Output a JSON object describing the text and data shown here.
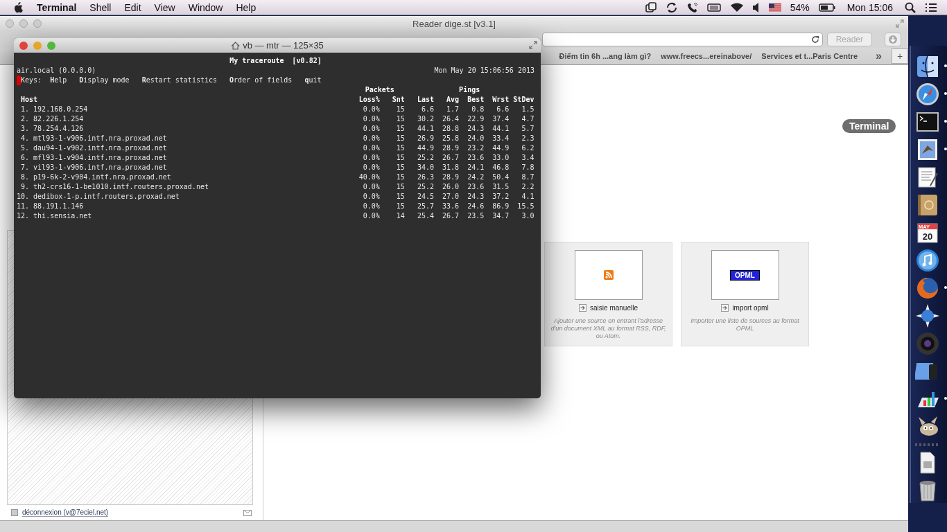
{
  "menu_bar": {
    "app": "Terminal",
    "menus": [
      "Shell",
      "Edit",
      "View",
      "Window",
      "Help"
    ],
    "battery": "54%",
    "clock": "Mon 15:06"
  },
  "browser": {
    "title": "Reader dige.st [v3.1]",
    "reader_button": "Reader",
    "bookmarks": [
      "Điểm tin 6h ...ang làm gì?",
      "www.freecs...ereinabove/",
      "Services et t...Paris Centre"
    ],
    "more": "»",
    "new_tab": "+",
    "sources": [
      {
        "kind": "rss",
        "label": "saisie manuelle",
        "description": "Ajouter une source en entrant l'adresse d'un document XML au format RSS, RDF, ou Atom."
      },
      {
        "kind": "opml",
        "badge": "OPML",
        "label": "import opml",
        "description": "Importer une liste de sources au format OPML"
      }
    ],
    "logout": "déconnexion (v@7eciel.net)"
  },
  "terminal": {
    "title": "vb — mtr — 125×35",
    "heading": "My traceroute  [v0.82]",
    "host": "air.local (0.0.0.0)",
    "timestamp": "Mon May 20 15:06:56 2013",
    "keys_label": "Keys:",
    "keys": [
      "**H**elp",
      "**D**isplay mode",
      "**R**estart statistics",
      "**O**rder of fields",
      "**q**uit"
    ],
    "groups": [
      "Packets",
      "Pings"
    ],
    "columns": [
      "Host",
      "Loss%",
      "Snt",
      "Last",
      "Avg",
      "Best",
      "Wrst",
      "StDev"
    ],
    "rows": [
      [
        "1. 192.168.0.254",
        "0.0%",
        "15",
        "6.6",
        "1.7",
        "0.8",
        "6.6",
        "1.5"
      ],
      [
        "2. 82.226.1.254",
        "0.0%",
        "15",
        "30.2",
        "26.4",
        "22.9",
        "37.4",
        "4.7"
      ],
      [
        "3. 78.254.4.126",
        "0.0%",
        "15",
        "44.1",
        "28.8",
        "24.3",
        "44.1",
        "5.7"
      ],
      [
        "4. mtl93-1-v906.intf.nra.proxad.net",
        "0.0%",
        "15",
        "26.9",
        "25.8",
        "24.0",
        "33.4",
        "2.3"
      ],
      [
        "5. dau94-1-v902.intf.nra.proxad.net",
        "0.0%",
        "15",
        "44.9",
        "28.9",
        "23.2",
        "44.9",
        "6.2"
      ],
      [
        "6. mfl93-1-v904.intf.nra.proxad.net",
        "0.0%",
        "15",
        "25.2",
        "26.7",
        "23.6",
        "33.0",
        "3.4"
      ],
      [
        "7. vil93-1-v906.intf.nra.proxad.net",
        "0.0%",
        "15",
        "34.0",
        "31.8",
        "24.1",
        "46.8",
        "7.8"
      ],
      [
        "8. p19-6k-2-v904.intf.nra.proxad.net",
        "40.0%",
        "15",
        "26.3",
        "28.9",
        "24.2",
        "50.4",
        "8.7"
      ],
      [
        "9. th2-crs16-1-be1010.intf.routers.proxad.net",
        "0.0%",
        "15",
        "25.2",
        "26.0",
        "23.6",
        "31.5",
        "2.2"
      ],
      [
        "10. dedibox-1-p.intf.routers.proxad.net",
        "0.0%",
        "15",
        "24.5",
        "27.0",
        "24.3",
        "37.2",
        "4.1"
      ],
      [
        "11. 88.191.1.146",
        "0.0%",
        "15",
        "25.7",
        "33.6",
        "24.6",
        "86.9",
        "15.5"
      ],
      [
        "12. thi.sensia.net",
        "0.0%",
        "14",
        "25.4",
        "26.7",
        "23.5",
        "34.7",
        "3.0"
      ]
    ]
  },
  "dock": {
    "tooltip": "Terminal",
    "apps": [
      {
        "kind": "finder",
        "running": true
      },
      {
        "kind": "safari",
        "running": true
      },
      {
        "kind": "terminal",
        "running": true
      },
      {
        "kind": "mail",
        "running": true
      },
      {
        "kind": "textedit",
        "running": false
      },
      {
        "kind": "contacts",
        "running": false
      },
      {
        "kind": "calendar",
        "running": false,
        "month": "MAY",
        "day": "20"
      },
      {
        "kind": "itunes",
        "running": false
      },
      {
        "kind": "firefox",
        "running": true
      },
      {
        "kind": "network",
        "running": false
      },
      {
        "kind": "camera",
        "running": false
      },
      {
        "kind": "xcode",
        "running": false
      },
      {
        "kind": "keynote",
        "running": true
      },
      {
        "kind": "gimp",
        "running": false
      },
      {
        "kind": "separator"
      },
      {
        "kind": "downloads",
        "running": false
      },
      {
        "kind": "trash",
        "running": false
      }
    ]
  }
}
